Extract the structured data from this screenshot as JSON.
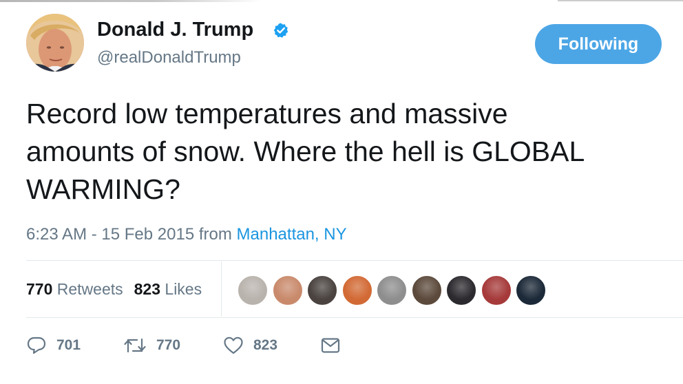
{
  "tweet": {
    "author": {
      "display_name": "Donald J. Trump",
      "username": "@realDonaldTrump",
      "verified": true
    },
    "follow_button_label": "Following",
    "text_lines": [
      "Record low temperatures and massive",
      "amounts of snow. Where the hell is GLOBAL",
      "WARMING?"
    ],
    "time": "6:23 AM - 15 Feb 2015",
    "from_label": "from",
    "location": "Manhattan, NY",
    "stats": {
      "retweets_count": "770",
      "retweets_label": "Retweets",
      "likes_count": "823",
      "likes_label": "Likes"
    },
    "liker_avatars": [
      {
        "name": "liker-avatar-1",
        "color": "#b9b3ad"
      },
      {
        "name": "liker-avatar-2",
        "color": "#c98a6c"
      },
      {
        "name": "liker-avatar-3",
        "color": "#4a4340"
      },
      {
        "name": "liker-avatar-4",
        "color": "#d26a35"
      },
      {
        "name": "liker-avatar-5",
        "color": "#8e8e8e"
      },
      {
        "name": "liker-avatar-6",
        "color": "#5c4a3c"
      },
      {
        "name": "liker-avatar-7",
        "color": "#2c2a2e"
      },
      {
        "name": "liker-avatar-8",
        "color": "#a63a3a"
      },
      {
        "name": "liker-avatar-9",
        "color": "#1c2938"
      }
    ],
    "actions": {
      "reply_count": "701",
      "retweet_count": "770",
      "like_count": "823"
    },
    "colors": {
      "accent": "#4ca6e6",
      "link": "#1b95e0",
      "muted": "#657786",
      "text": "#14171a",
      "divider": "#e1e8ed"
    },
    "icons": {
      "verified": "verified-badge-icon",
      "reply": "reply-icon",
      "retweet": "retweet-icon",
      "like": "heart-icon",
      "message": "envelope-icon"
    }
  }
}
